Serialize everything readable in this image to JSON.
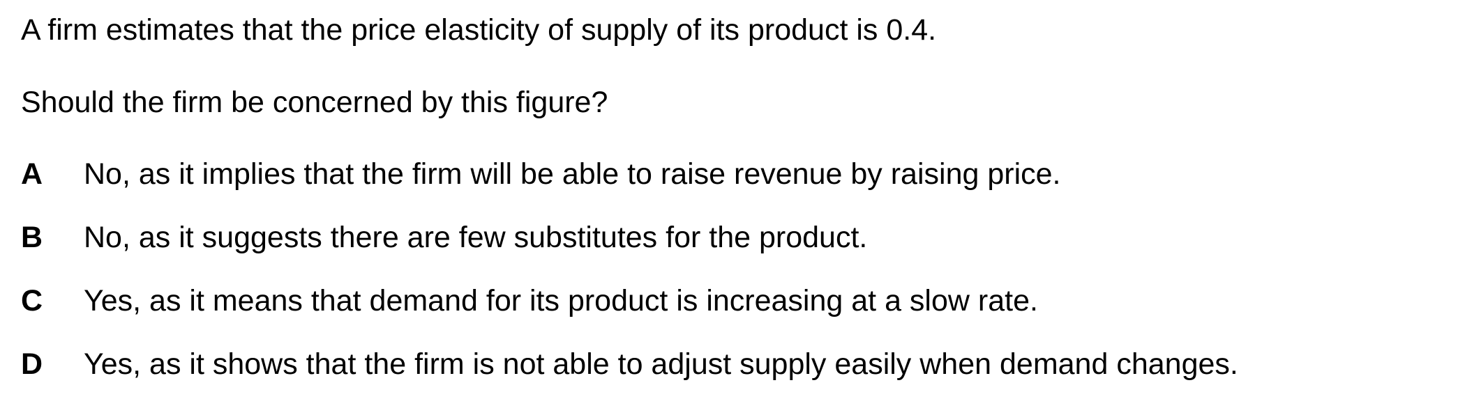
{
  "question": {
    "stem": "A firm estimates that the price elasticity of supply of its product is 0.4.",
    "prompt": "Should the firm be concerned by this figure?",
    "options": [
      {
        "letter": "A",
        "text": "No, as it implies that the firm will be able to raise revenue by raising price."
      },
      {
        "letter": "B",
        "text": "No, as it suggests there are few substitutes for the product."
      },
      {
        "letter": "C",
        "text": "Yes, as it means that demand for its product is increasing at a slow rate."
      },
      {
        "letter": "D",
        "text": "Yes, as it shows that the firm is not able to adjust supply easily when demand changes."
      }
    ]
  }
}
